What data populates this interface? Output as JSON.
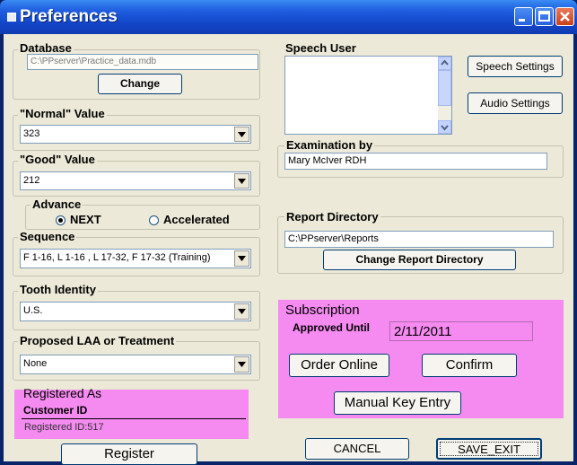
{
  "window": {
    "title": "Preferences"
  },
  "database": {
    "label": "Database",
    "path": "C:\\PPserver\\Practice_data.mdb",
    "change_button": "Change"
  },
  "normal_value": {
    "label": "\"Normal\" Value",
    "value": "323"
  },
  "good_value": {
    "label": "\"Good\"  Value",
    "value": "212"
  },
  "advance": {
    "label": "Advance",
    "options": [
      "NEXT",
      "Accelerated"
    ],
    "selected": "NEXT"
  },
  "sequence": {
    "label": "Sequence",
    "value": "F 1-16, L 1-16 , L 17-32, F 17-32 (Training)"
  },
  "tooth_identity": {
    "label": "Tooth Identity",
    "value": "U.S."
  },
  "proposed": {
    "label": "Proposed  LAA or Treatment",
    "value": "None"
  },
  "registered": {
    "label": "Registered As",
    "customer_id_label": "Customer ID",
    "value": "Registered ID:517",
    "register_button": "Register"
  },
  "speech_user": {
    "label": "Speech User",
    "speech_settings_button": "Speech Settings",
    "audio_settings_button": "Audio Settings"
  },
  "examination": {
    "label": "Examination by",
    "value": "Mary McIver RDH"
  },
  "report_directory": {
    "label": "Report Directory",
    "value": "C:\\PPserver\\Reports",
    "change_button": "Change Report Directory"
  },
  "subscription": {
    "label": "Subscription",
    "approved_label": "Approved Until",
    "approved_value": "2/11/2011",
    "order_button": "Order Online",
    "confirm_button": "Confirm",
    "manual_button": "Manual Key Entry"
  },
  "footer": {
    "cancel_button": "CANCEL",
    "save_button": "SAVE_EXIT"
  },
  "colors": {
    "highlight": "#F58AF0",
    "titlebar": "#1f5fe0",
    "dialog": "#ECE9D8"
  }
}
